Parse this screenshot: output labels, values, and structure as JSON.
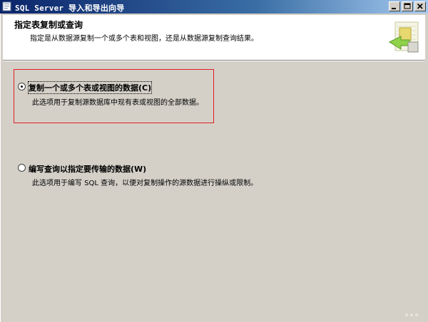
{
  "window": {
    "title": "SQL Server 导入和导出向导",
    "icon": "wizard-app-icon",
    "buttons": [
      "minimize-icon",
      "maximize-icon",
      "close-icon"
    ]
  },
  "header": {
    "title": "指定表复制或查询",
    "subtitle": "指定是从数据源复制一个或多个表和视图，还是从数据源复制查询结果。",
    "icon": "wizard-banner-icon"
  },
  "options": [
    {
      "label": "复制一个或多个表或视图的数据(C)",
      "description": "此选项用于复制源数据库中现有表或视图的全部数据。",
      "selected": true
    },
    {
      "label": "编写查询以指定要传输的数据(W)",
      "description": "此选项用于编写 SQL 查询，以便对复制操作的源数据进行操纵或限制。",
      "selected": false
    }
  ],
  "colors": {
    "titlebar_start": "#0a246a",
    "titlebar_end": "#a6caf0",
    "highlight_border": "#e02020",
    "dialog_background": "#d4d0c8"
  }
}
